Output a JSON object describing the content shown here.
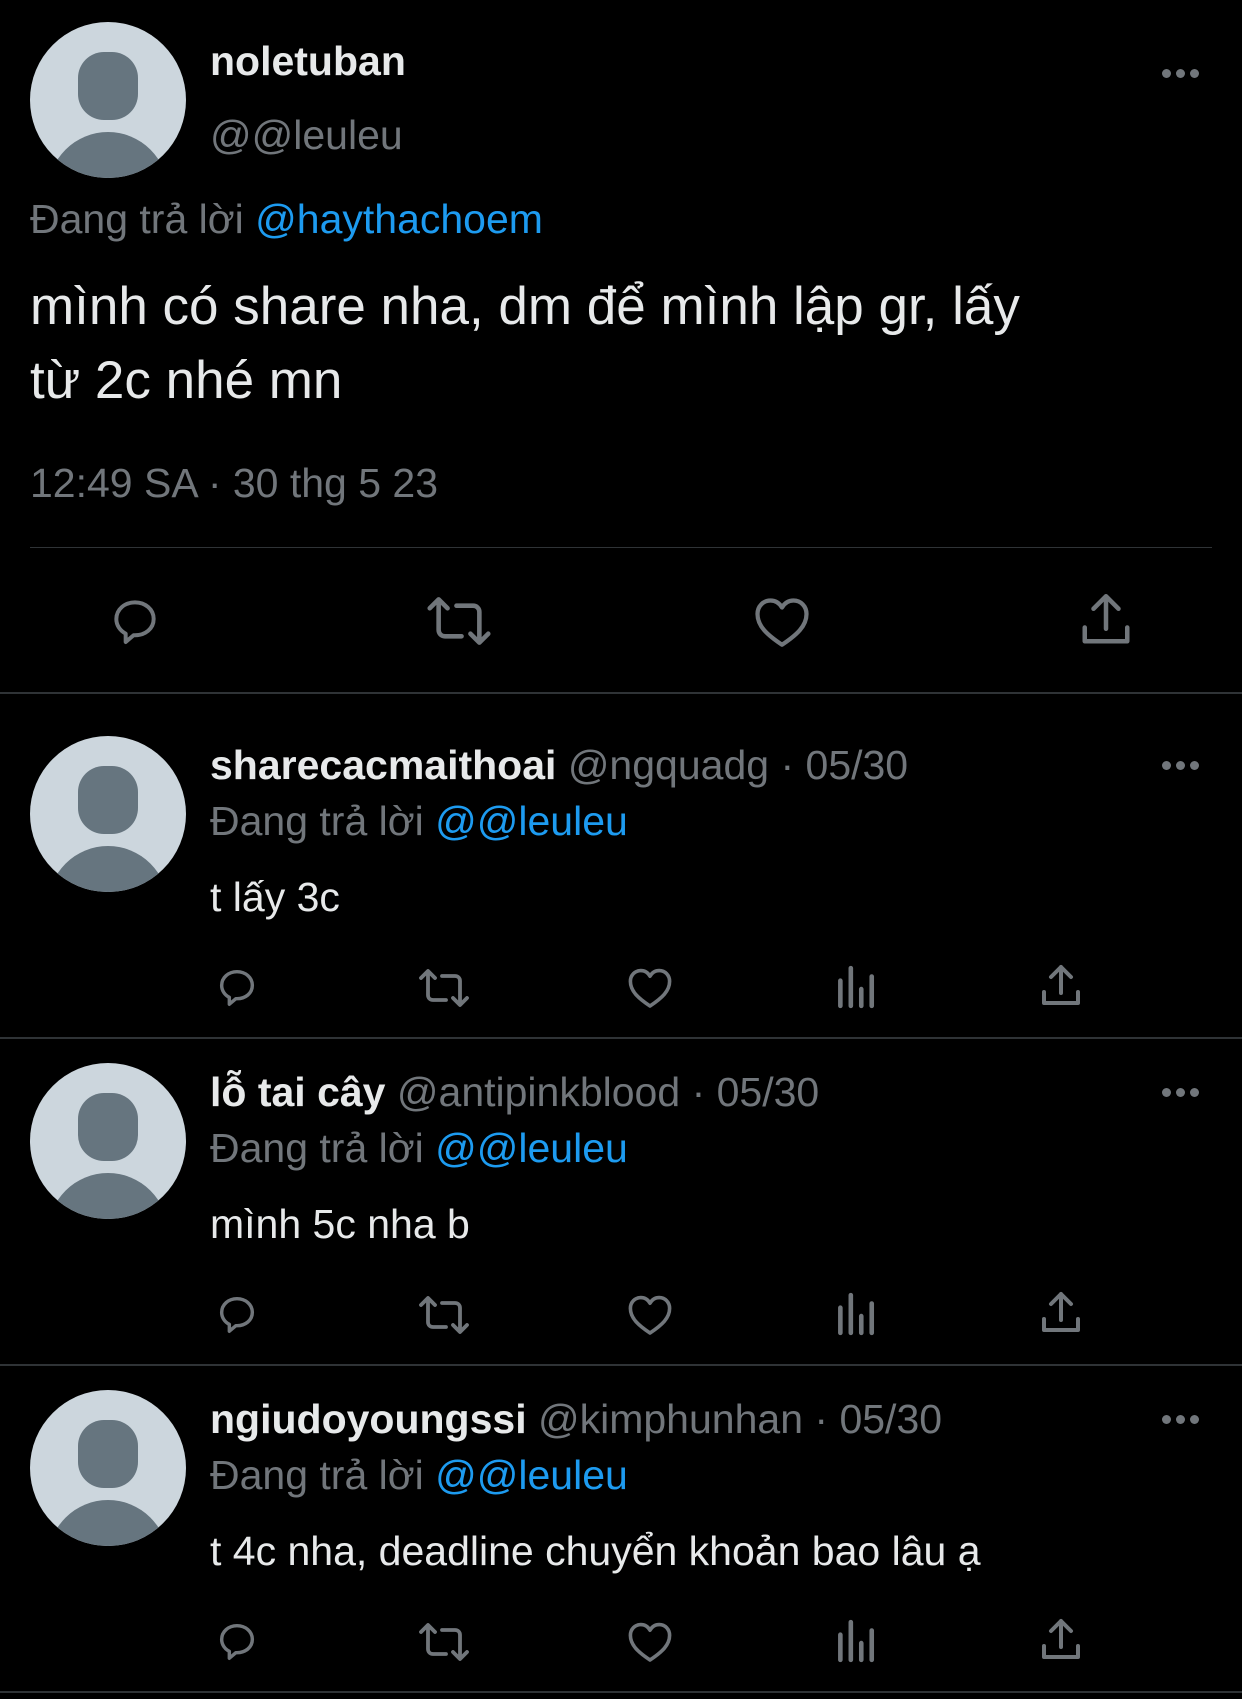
{
  "main_tweet": {
    "display_name": "noletuban",
    "handle": "@@leuleu",
    "replying_prefix": "Đang trả lời",
    "replying_to": "@haythachoem",
    "text_line1": "mình có share nha, dm để mình lập gr, lấy",
    "text_line2": "từ 2c nhé mn",
    "timestamp": "12:49 SA · 30 thg 5 23"
  },
  "replies": [
    {
      "display_name": "sharecacmaithoai",
      "handle": "@ngquadg",
      "date": "· 05/30",
      "replying_prefix": "Đang trả lời",
      "replying_to": "@@leuleu",
      "text": "t lấy 3c"
    },
    {
      "display_name": "lỗ tai cây",
      "handle": "@antipinkblood",
      "date": "· 05/30",
      "replying_prefix": "Đang trả lời",
      "replying_to": "@@leuleu",
      "text": "mình 5c nha b"
    },
    {
      "display_name": "ngiudoyoungssi",
      "handle": "@kimphunhan",
      "date": "· 05/30",
      "replying_prefix": "Đang trả lời",
      "replying_to": "@@leuleu",
      "text": "t 4c nha, deadline chuyển khoản bao lâu ạ"
    }
  ],
  "icons": {
    "reply": "reply-icon",
    "retweet": "retweet-icon",
    "like": "heart-icon",
    "views": "views-icon",
    "share": "share-icon",
    "more": "more-icon"
  },
  "colors": {
    "background": "#000000",
    "text": "#e7e9ea",
    "muted": "#71767b",
    "link": "#1d9bf0",
    "divider": "#2f3336"
  }
}
